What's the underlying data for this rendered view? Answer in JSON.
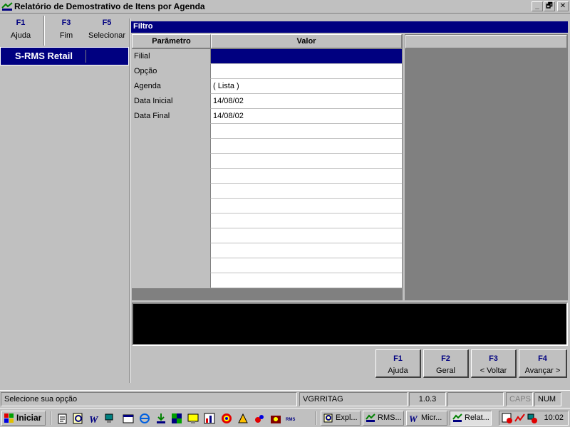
{
  "window": {
    "title": "Relatório de Demostrativo de Itens por Agenda",
    "controls": [
      "_",
      "🗗",
      "✕"
    ]
  },
  "toolbar": {
    "keys": [
      {
        "key": "F1",
        "label": "Ajuda"
      },
      {
        "key": "F3",
        "label": "Fim"
      },
      {
        "key": "F5",
        "label": "Selecionar"
      }
    ]
  },
  "module": {
    "label": "S-RMS Retail"
  },
  "filter": {
    "title": "Filtro",
    "headers": {
      "param": "Parâmetro",
      "value": "Valor"
    },
    "rows": [
      {
        "param": "Filial",
        "value": ""
      },
      {
        "param": "Opção",
        "value": ""
      },
      {
        "param": "Agenda",
        "value": "( Lista )"
      },
      {
        "param": "Data Inicial",
        "value": "14/08/02"
      },
      {
        "param": "Data Final",
        "value": "14/08/02"
      },
      {
        "param": "",
        "value": ""
      },
      {
        "param": "",
        "value": ""
      },
      {
        "param": "",
        "value": ""
      },
      {
        "param": "",
        "value": ""
      },
      {
        "param": "",
        "value": ""
      },
      {
        "param": "",
        "value": ""
      },
      {
        "param": "",
        "value": ""
      },
      {
        "param": "",
        "value": ""
      },
      {
        "param": "",
        "value": ""
      },
      {
        "param": "",
        "value": ""
      },
      {
        "param": "",
        "value": ""
      }
    ]
  },
  "nav": [
    {
      "key": "F1",
      "label": "Ajuda"
    },
    {
      "key": "F2",
      "label": "Geral"
    },
    {
      "key": "F3",
      "label": "< Voltar"
    },
    {
      "key": "F4",
      "label": "Avançar >"
    }
  ],
  "status": {
    "message": "Selecione sua opção",
    "program": "VGRRITAG",
    "version": "1.0.3",
    "caps": "CAPS",
    "num": "NUM"
  },
  "taskbar": {
    "start": "Iniciar",
    "tasks": [
      "Expl...",
      "RMS...",
      "Micr...",
      "Relat..."
    ],
    "clock": "10:02"
  },
  "colors": {
    "accent": "#000080",
    "face": "#c0c0c0",
    "shadow": "#808080"
  }
}
